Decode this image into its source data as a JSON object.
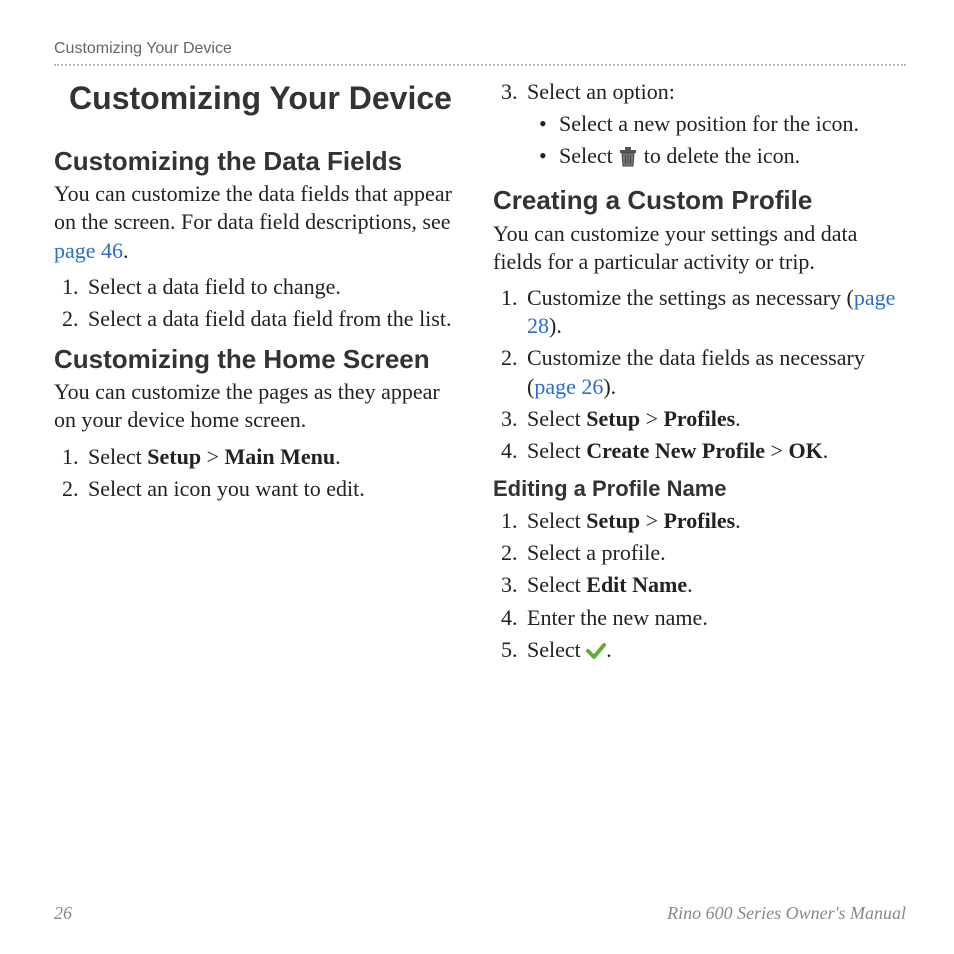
{
  "running_head": "Customizing Your Device",
  "title": "Customizing Your Device",
  "left": {
    "sect1": {
      "heading": "Customizing the Data Fields",
      "intro_pre": "You can customize the data fields that appear on the screen. For data field descriptions, see ",
      "intro_link": "page 46",
      "intro_post": ".",
      "steps": [
        "Select a data field to change.",
        "Select a data field data field from the list."
      ]
    },
    "sect2": {
      "heading": "Customizing the Home Screen",
      "intro": "You can customize the pages as they appear on your device home screen.",
      "step1_pre": "Select ",
      "step1_b1": "Setup",
      "step1_gt": " > ",
      "step1_b2": "Main Menu",
      "step1_post": ".",
      "step2": "Select an icon you want to edit."
    }
  },
  "right": {
    "continued": {
      "step3_label": "Select an option:",
      "bullets": {
        "b1": "Select a new position for the icon.",
        "b2_pre": "Select ",
        "b2_post": " to delete the icon."
      }
    },
    "sect3": {
      "heading": "Creating a Custom Profile",
      "intro": "You can customize your settings and data fields for a particular activity or trip.",
      "s1_pre": "Customize the settings as necessary (",
      "s1_link": "page 28",
      "s1_post": ").",
      "s2_pre": "Customize the data fields as necessary (",
      "s2_link": "page 26",
      "s2_post": ").",
      "s3_pre": "Select ",
      "s3_b1": "Setup",
      "s3_gt": " > ",
      "s3_b2": "Profiles",
      "s3_post": ".",
      "s4_pre": "Select ",
      "s4_b1": "Create New Profile",
      "s4_gt": " > ",
      "s4_b2": "OK",
      "s4_post": "."
    },
    "sect4": {
      "heading": "Editing a Profile Name",
      "s1_pre": "Select ",
      "s1_b1": "Setup",
      "s1_gt": " > ",
      "s1_b2": "Profiles",
      "s1_post": ".",
      "s2": "Select a profile.",
      "s3_pre": "Select ",
      "s3_b1": "Edit Name",
      "s3_post": ".",
      "s4": "Enter the new name.",
      "s5_pre": "Select ",
      "s5_post": "."
    }
  },
  "footer": {
    "page": "26",
    "book": "Rino 600 Series Owner's Manual"
  },
  "icons": {
    "trash": "trash-icon",
    "check": "checkmark-icon"
  }
}
